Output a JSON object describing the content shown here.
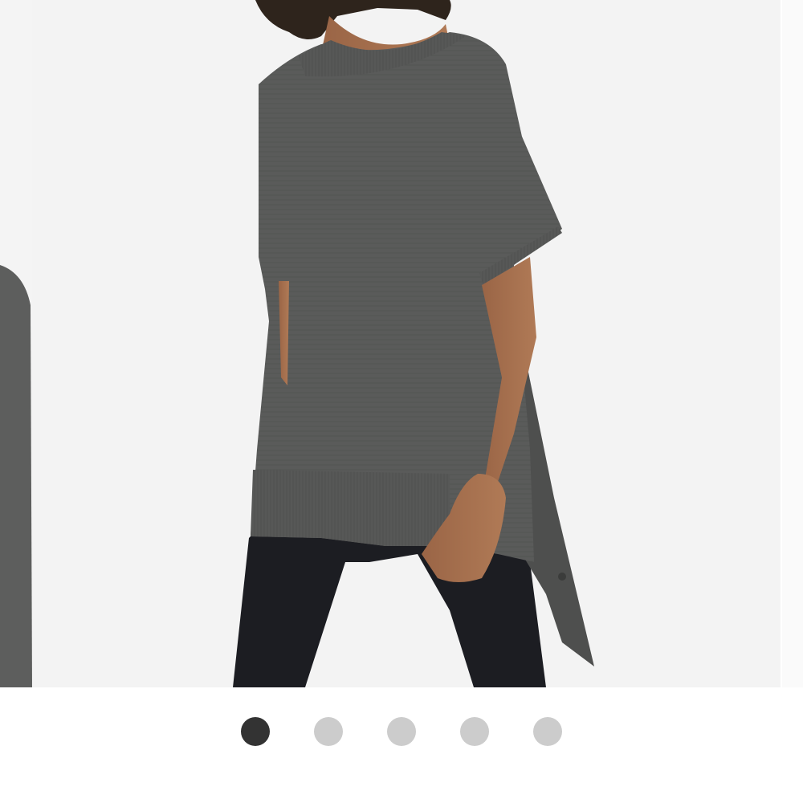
{
  "carousel": {
    "slide_count": 5,
    "active_index": 0,
    "colors": {
      "background": "#f3f3f3",
      "garment": "#5a5b5a",
      "leggings": "#1c1d22",
      "skin": "#a5704e",
      "dot_active": "#333333",
      "dot_inactive": "#cccccc"
    },
    "dots": [
      {
        "state": "active"
      },
      {
        "state": "inactive"
      },
      {
        "state": "inactive"
      },
      {
        "state": "inactive"
      },
      {
        "state": "inactive"
      }
    ]
  }
}
